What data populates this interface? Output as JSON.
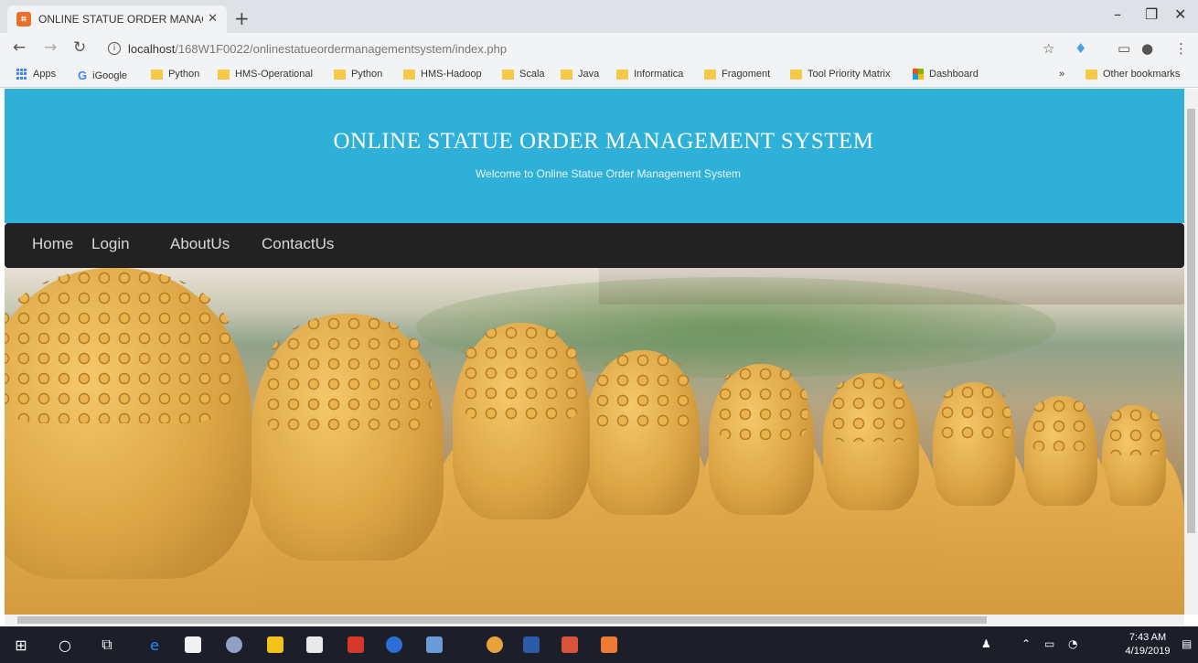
{
  "browser": {
    "tab_title": "ONLINE STATUE ORDER MANAGE",
    "tab_favicon_text": "⌗",
    "url_host": "localhost",
    "url_path": "/168W1F0022/onlinestatueordermanagementsystem/index.php",
    "bookmarks": [
      {
        "label": "Apps",
        "icon": "apps-icon"
      },
      {
        "label": "iGoogle",
        "icon": "google-icon"
      },
      {
        "label": "Python",
        "icon": "folder-icon"
      },
      {
        "label": "HMS-Operational",
        "icon": "folder-icon"
      },
      {
        "label": "Python",
        "icon": "folder-icon"
      },
      {
        "label": "HMS-Hadoop",
        "icon": "folder-icon"
      },
      {
        "label": "Scala",
        "icon": "folder-icon"
      },
      {
        "label": "Java",
        "icon": "folder-icon"
      },
      {
        "label": "Informatica",
        "icon": "folder-icon"
      },
      {
        "label": "Fragoment",
        "icon": "folder-icon"
      },
      {
        "label": "Tool Priority Matrix",
        "icon": "folder-icon"
      },
      {
        "label": "Dashboard",
        "icon": "dashboard-icon"
      }
    ],
    "more_bookmarks": "»",
    "other_bookmarks": "Other bookmarks"
  },
  "site": {
    "title": "ONLINE STATUE ORDER MANAGEMENT SYSTEM",
    "subtitle": "Welcome to Online Statue Order Management System",
    "nav": [
      "Home",
      "Login",
      "AboutUs",
      "ContactUs"
    ],
    "header_color": "#2fb0d8",
    "nav_color": "#222222"
  },
  "taskbar": {
    "time": "7:43 AM",
    "date": "4/19/2019"
  }
}
